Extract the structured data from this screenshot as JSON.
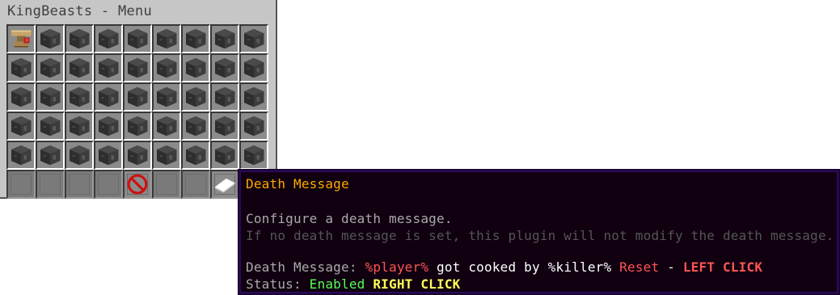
{
  "window": {
    "title": "KingBeasts - Menu"
  },
  "grid": {
    "rows": 5,
    "columns": 9,
    "first_slot_icon": "anvil-icon",
    "slot_icon": "locked-cube-icon"
  },
  "bottom_row": [
    {
      "icon": "gray-pane-icon"
    },
    {
      "icon": "gray-pane-icon"
    },
    {
      "icon": "gray-pane-icon"
    },
    {
      "icon": "gray-pane-icon"
    },
    {
      "icon": "barrier-icon"
    },
    {
      "icon": "gray-pane-icon"
    },
    {
      "icon": "gray-pane-icon"
    },
    {
      "icon": "paper-icon"
    }
  ],
  "tooltip": {
    "title": "Death Message",
    "description": "Configure a death message.",
    "description_note": "If no death message is set, this plugin will not modify the death message.",
    "message_label": "Death Message: ",
    "message_player": "%player%",
    "message_mid": " got cooked by ",
    "message_killer": "%killer%",
    "message_reset": " Reset",
    "message_dash": " - ",
    "message_action": "LEFT CLICK",
    "status_label": "Status: ",
    "status_value": "Enabled",
    "status_action": " RIGHT CLICK"
  },
  "colors": {
    "title": "#ffaa00",
    "text_gray": "#aaaaaa",
    "text_dark_gray": "#555555",
    "red": "#ff5555",
    "green": "#55ff55",
    "yellow": "#ffff55",
    "tooltip_bg": "#100010",
    "tooltip_border": "#2a0a5a"
  }
}
